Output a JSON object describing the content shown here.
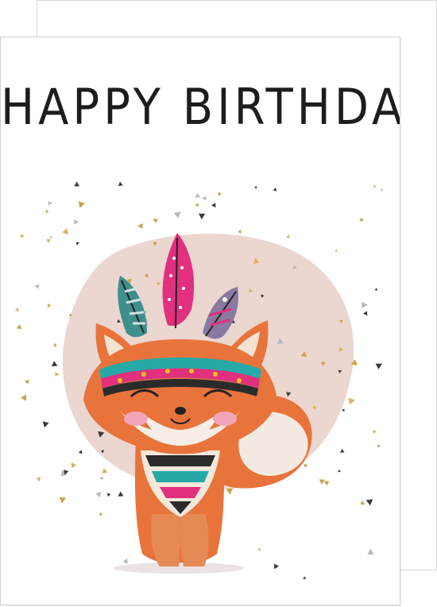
{
  "card": {
    "title": "HAPPY BIRTHDAY"
  },
  "illustration": {
    "subject": "fox-with-feather-headband",
    "colors": {
      "fox_orange": "#e8743b",
      "blob_pink": "#ecd6d0",
      "feather_magenta": "#e0307e",
      "headband_teal": "#27a9a8",
      "confetti_gold": "#c9a24a",
      "confetti_dark": "#3b3b3b"
    }
  }
}
